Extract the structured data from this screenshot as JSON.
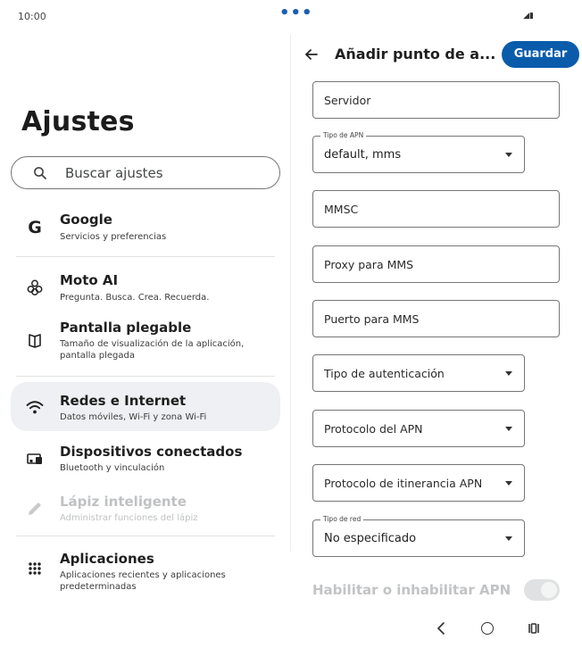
{
  "status_bar": {
    "time": "10:00",
    "dots": "•••",
    "icons": "◢▮"
  },
  "settings": {
    "title": "Ajustes",
    "search_placeholder": "Buscar ajustes",
    "items": [
      {
        "title": "Google",
        "subtitle": "Servicios y preferencias",
        "icon": "google-g-icon"
      },
      {
        "title": "Moto AI",
        "subtitle": "Pregunta. Busca. Crea. Recuerda.",
        "icon": "moto-ai-icon"
      },
      {
        "title": "Pantalla plegable",
        "subtitle": "Tamaño de visualización de la aplicación, pantalla plegada",
        "icon": "foldable-icon"
      },
      {
        "title": "Redes e Internet",
        "subtitle": "Datos móviles, Wi-Fi y zona Wi-Fi",
        "icon": "wifi-icon"
      },
      {
        "title": "Dispositivos conectados",
        "subtitle": "Bluetooth y vinculación",
        "icon": "devices-icon"
      },
      {
        "title": "Lápiz inteligente",
        "subtitle": "Administrar funciones del lápiz",
        "icon": "stylus-icon"
      },
      {
        "title": "Aplicaciones",
        "subtitle": "Aplicaciones recientes y aplicaciones predeterminadas",
        "icon": "apps-grid-icon"
      }
    ],
    "selected_item": "Redes e Internet",
    "disabled_item": "Lápiz inteligente"
  },
  "apn": {
    "title": "Añadir punto de a...",
    "save_label": "Guardar",
    "fields": {
      "server": {
        "placeholder": "Servidor"
      },
      "apn_type": {
        "label": "Tipo de APN",
        "value": "default, mms"
      },
      "mmsc": {
        "placeholder": "MMSC"
      },
      "mms_proxy": {
        "placeholder": "Proxy para MMS"
      },
      "mms_port": {
        "placeholder": "Puerto para MMS"
      },
      "auth_type": {
        "placeholder": "Tipo de autenticación"
      },
      "apn_protocol": {
        "placeholder": "Protocolo del APN"
      },
      "roaming_protocol": {
        "placeholder": "Protocolo de itinerancia APN"
      },
      "network_type": {
        "label": "Tipo de red",
        "value": "No especificado"
      }
    },
    "toggle": {
      "label": "Habilitar o inhabilitar APN",
      "enabled": true,
      "disabled_state": true
    }
  },
  "colors": {
    "accent": "#0a5cab",
    "selected_bg": "#eef0f3",
    "outline": "#747775",
    "disabled_text": "#bfc1c3"
  }
}
